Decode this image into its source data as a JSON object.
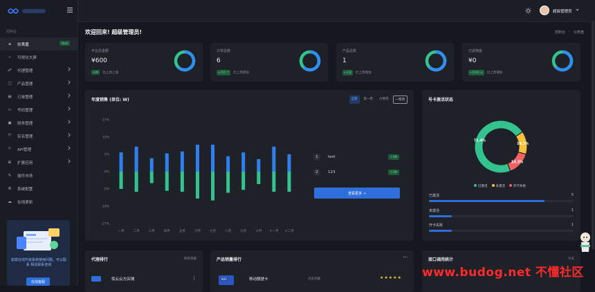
{
  "sidebar": {
    "section_label": "控制台",
    "items": [
      {
        "label": "仪表盘",
        "icon": "home-icon",
        "badge": "New",
        "active": true
      },
      {
        "label": "可视化大屏",
        "icon": "pulse-icon"
      },
      {
        "label": "代理管理",
        "icon": "agent-icon",
        "chevron": true
      },
      {
        "label": "产品管理",
        "icon": "box-icon",
        "chevron": true
      },
      {
        "label": "订单管理",
        "icon": "order-icon",
        "chevron": true
      },
      {
        "label": "号码管理",
        "icon": "card-icon",
        "chevron": true
      },
      {
        "label": "财务管理",
        "icon": "wallet-icon",
        "chevron": true
      },
      {
        "label": "实名管理",
        "icon": "shield-icon",
        "chevron": true
      },
      {
        "label": "API管理",
        "icon": "api-icon",
        "chevron": true
      },
      {
        "label": "扩展应用",
        "icon": "apps-icon",
        "chevron": true
      },
      {
        "label": "插件市场",
        "icon": "plugin-icon"
      },
      {
        "label": "系统配置",
        "icon": "settings-icon"
      },
      {
        "label": "在线更新",
        "icon": "cloud-icon"
      }
    ],
    "promo": {
      "text": "如需在线升级系统使用问题，可以联系 相关联系咨询",
      "button": "在线客服"
    }
  },
  "topbar": {
    "username": "超级管理员"
  },
  "main": {
    "welcome": "欢迎回来! 超级管理员!",
    "breadcrumb": [
      "控制台",
      "仪表盘"
    ],
    "stats": [
      {
        "label": "平台总金额",
        "value": "¥600",
        "delta": "+¥0",
        "delta_text": "比上周上涨",
        "ring": 0.62,
        "color": "#2f8ff5"
      },
      {
        "label": "订单总数",
        "value": "6",
        "delta": "+250 个",
        "delta_text": "比上周增加",
        "ring": 0.62,
        "color": "#2f8ff5"
      },
      {
        "label": "产品总数",
        "value": "1",
        "delta": "+3 款",
        "delta_text": "比上周增加",
        "ring": 0.62,
        "color": "#2f8ff5"
      },
      {
        "label": "已返佣金",
        "value": "¥0",
        "delta": "+1000 元",
        "delta_text": "比上周增加",
        "ring": 0.62,
        "color": "#2f8ff5"
      }
    ],
    "sales": {
      "title": "年度销售 (单位: W)",
      "filters": [
        "全部",
        "近一月",
        "六月内",
        "一年内"
      ],
      "ranking": [
        {
          "num": "1",
          "name": "test",
          "tag": "+4单"
        },
        {
          "num": "2",
          "name": "123",
          "tag": "+2单"
        }
      ],
      "more_button": "查看更多 →"
    },
    "activation": {
      "title": "号卡激活状态",
      "legend": [
        "已激活",
        "未激活",
        "开卡失败"
      ],
      "rows": [
        {
          "label": "已激活",
          "value": "5",
          "fill": 0.8
        },
        {
          "label": "未激活",
          "value": "1",
          "fill": 0.16
        },
        {
          "label": "开卡失败",
          "value": "1",
          "fill": 0.16
        }
      ]
    },
    "agent_rank": {
      "title": "代理排行",
      "filter": "所有等级",
      "first_name": "惊云云方店铺"
    },
    "product_rank": {
      "title": "产品销量排行",
      "first_name": "移动靓號卡",
      "first_sub": "点击次数",
      "chip": "80G"
    },
    "api_stats": {
      "title": "接口调用统计",
      "filter": "今天"
    }
  },
  "watermark": "www.budog.net 不懂社区",
  "colors": {
    "accent": "#2f6fdb",
    "green": "#34c38f",
    "yellow": "#f6c23e",
    "red": "#f06262"
  },
  "chart_data": [
    {
      "type": "bar",
      "title": "年度销售 (单位: W)",
      "categories": [
        "一月",
        "二月",
        "三月",
        "四月",
        "五月",
        "六月",
        "七月",
        "八月",
        "九月",
        "十月",
        "十一月",
        "十二月"
      ],
      "series": [
        {
          "values": [
            10,
            13,
            7,
            9.5,
            10.5,
            14,
            14,
            8,
            10,
            6.5,
            13,
            9
          ]
        },
        {
          "values": [
            -9,
            -10.5,
            -6,
            -10,
            -10.5,
            -14,
            -15,
            -11,
            -9.5,
            -6.5,
            -10.5,
            -10.5
          ]
        }
      ],
      "yticks": [
        "27%",
        "18%",
        "9%",
        "0%",
        "-9%",
        "-18%",
        "-27%"
      ],
      "ylim": [
        -27,
        27
      ],
      "colors": [
        "#2f80ed",
        "#34c38f"
      ]
    },
    {
      "type": "pie",
      "title": "号卡激活状态",
      "categories": [
        "已激活",
        "未激活",
        "开卡失败"
      ],
      "values": [
        71.4,
        14.3,
        14.3
      ],
      "labels": [
        "71.4%",
        "14.3%",
        "14.3%"
      ],
      "colors": [
        "#34c38f",
        "#f6c23e",
        "#f06262"
      ],
      "legend": "bottom"
    }
  ]
}
